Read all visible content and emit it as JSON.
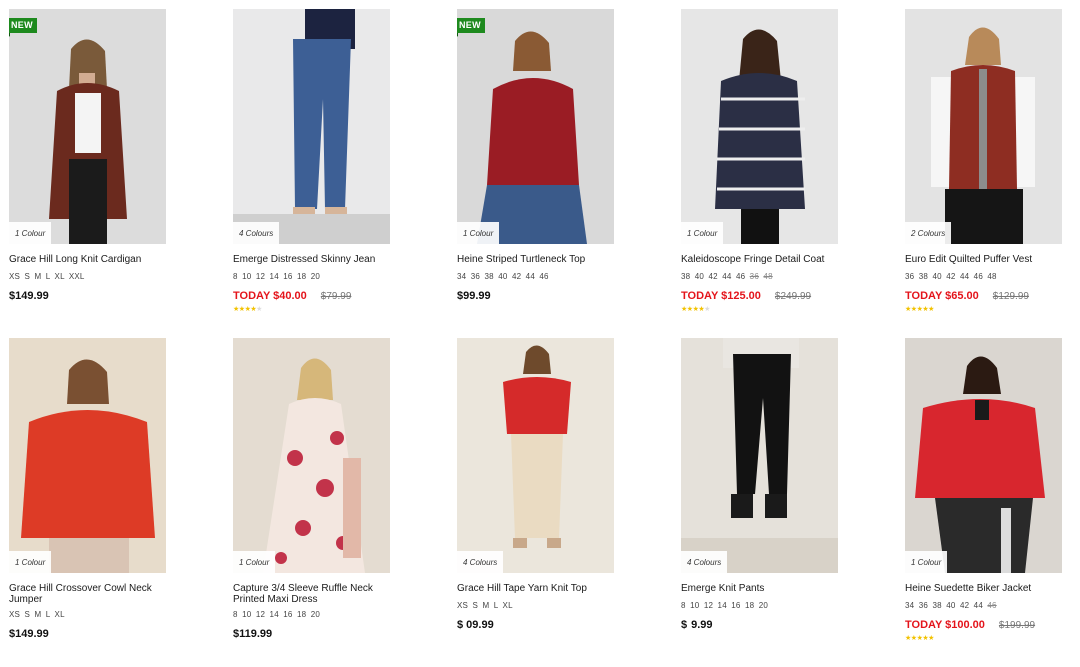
{
  "products": [
    {
      "name": "Grace Hill Long Knit Cardigan",
      "badge": "NEW",
      "colours": "1 Colour",
      "sizes": [
        "XS",
        "S",
        "M",
        "L",
        "XL",
        "XXL"
      ],
      "sizes_unavailable": [],
      "price": "$149.99",
      "sale_price": "",
      "was_price": "",
      "rating": 0,
      "bg": "#dcdcdc"
    },
    {
      "name": "Emerge Distressed Skinny Jean",
      "badge": "",
      "colours": "4 Colours",
      "sizes": [
        "8",
        "10",
        "12",
        "14",
        "16",
        "18",
        "20"
      ],
      "sizes_unavailable": [],
      "price": "",
      "sale_price": "TODAY $40.00",
      "was_price": "$79.99",
      "rating": 4,
      "bg": "#e9e9ea"
    },
    {
      "name": "Heine Striped Turtleneck Top",
      "badge": "NEW",
      "colours": "1 Colour",
      "sizes": [
        "34",
        "36",
        "38",
        "40",
        "42",
        "44",
        "46"
      ],
      "sizes_unavailable": [],
      "price": "$99.99",
      "sale_price": "",
      "was_price": "",
      "rating": 0,
      "bg": "#d9d9d9"
    },
    {
      "name": "Kaleidoscope Fringe Detail Coat",
      "badge": "",
      "colours": "1 Colour",
      "sizes": [
        "38",
        "40",
        "42",
        "44",
        "46"
      ],
      "sizes_unavailable": [
        "36",
        "48"
      ],
      "price": "",
      "sale_price": "TODAY $125.00",
      "was_price": "$249.99",
      "rating": 4,
      "bg": "#e6e6e6"
    },
    {
      "name": "Euro Edit Quilted Puffer Vest",
      "badge": "",
      "colours": "2 Colours",
      "sizes": [
        "36",
        "38",
        "40",
        "42",
        "44",
        "46",
        "48"
      ],
      "sizes_unavailable": [],
      "price": "",
      "sale_price": "TODAY $65.00",
      "was_price": "$129.99",
      "rating": 4.5,
      "bg": "#e3e3e3"
    },
    {
      "name": "Grace Hill Crossover Cowl Neck Jumper",
      "badge": "",
      "colours": "1 Colour",
      "sizes": [
        "XS",
        "S",
        "M",
        "L",
        "XL"
      ],
      "sizes_unavailable": [],
      "price": "$149.99",
      "sale_price": "",
      "was_price": "",
      "rating": 0,
      "bg": "#e7dccb"
    },
    {
      "name": "Capture 3/4 Sleeve Ruffle Neck Printed Maxi Dress",
      "badge": "",
      "colours": "1 Colour",
      "sizes": [
        "8",
        "10",
        "12",
        "14",
        "16",
        "18",
        "20"
      ],
      "sizes_unavailable": [],
      "price": "$119.99",
      "sale_price": "",
      "was_price": "",
      "rating": 0,
      "bg": "#e4dcd1"
    },
    {
      "name": "Grace Hill Tape Yarn Knit Top",
      "badge": "",
      "colours": "4 Colours",
      "sizes": [
        "XS",
        "S",
        "M",
        "L",
        "XL"
      ],
      "sizes_unavailable": [],
      "price": "$ 09.99",
      "sale_price": "",
      "was_price": "",
      "rating": 0,
      "bg": "#ebe6dc"
    },
    {
      "name": "Emerge Knit Pants",
      "badge": "",
      "colours": "4 Colours",
      "sizes": [
        "8",
        "10",
        "12",
        "14",
        "16",
        "18",
        "20"
      ],
      "sizes_unavailable": [],
      "price": "$  9.99",
      "sale_price": "",
      "was_price": "",
      "rating": 0,
      "bg": "#e5e1da"
    },
    {
      "name": "Heine Suedette Biker Jacket",
      "badge": "",
      "colours": "1 Colour",
      "sizes": [
        "34",
        "36",
        "38",
        "40",
        "42",
        "44"
      ],
      "sizes_unavailable": [
        "46"
      ],
      "price": "",
      "sale_price": "TODAY $100.00",
      "was_price": "$199.99",
      "rating": 4.5,
      "bg": "#dad6d0"
    }
  ],
  "colors": {
    "sale_red": "#e4141b",
    "badge_green": "#1e8a1e",
    "star_gold": "#f2c200"
  }
}
